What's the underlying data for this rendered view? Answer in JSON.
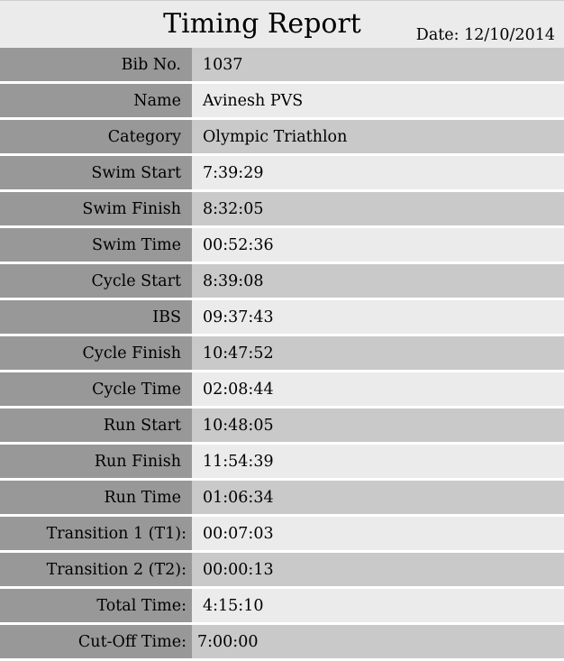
{
  "report": {
    "title": "Timing Report",
    "date_label": "Date:",
    "date": "12/10/2014"
  },
  "rows": [
    {
      "label": "Bib No.",
      "value": "1037"
    },
    {
      "label": "Name",
      "value": "Avinesh PVS"
    },
    {
      "label": "Category",
      "value": "Olympic Triathlon"
    },
    {
      "label": "Swim Start",
      "value": "7:39:29"
    },
    {
      "label": "Swim Finish",
      "value": "8:32:05"
    },
    {
      "label": "Swim Time",
      "value": "00:52:36"
    },
    {
      "label": "Cycle Start",
      "value": "8:39:08"
    },
    {
      "label": "IBS",
      "value": "09:37:43"
    },
    {
      "label": "Cycle Finish",
      "value": "10:47:52"
    },
    {
      "label": "Cycle Time",
      "value": "02:08:44"
    },
    {
      "label": "Run Start",
      "value": "10:48:05"
    },
    {
      "label": "Run Finish",
      "value": "11:54:39"
    },
    {
      "label": "Run Time",
      "value": "01:06:34"
    },
    {
      "label": "Transition 1 (T1):",
      "value": "00:07:03"
    },
    {
      "label": "Transition 2 (T2):",
      "value": "00:00:13"
    },
    {
      "label": "Total Time:",
      "value": "4:15:10"
    },
    {
      "label": "Cut-Off Time:",
      "value": "7:00:00"
    }
  ]
}
